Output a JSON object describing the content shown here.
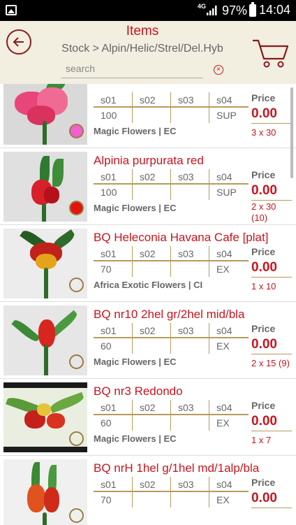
{
  "status_bar": {
    "network": "4G",
    "battery": "97%",
    "time": "14:04"
  },
  "header": {
    "title": "Items",
    "breadcrumb": "Stock > Alpin/Helic/Strel/Del.Hyb",
    "search_placeholder": "search"
  },
  "columns": [
    "s01",
    "s02",
    "s03",
    "s04"
  ],
  "price_label": "Price",
  "items": [
    {
      "name": "",
      "s01": "100",
      "s02": "",
      "s03": "",
      "s04": "SUP",
      "supplier": "Magic Flowers | EC",
      "price": "0.00",
      "packing": "3 x 30",
      "dot_color": "#f25fd0",
      "dot_filled": true
    },
    {
      "name": "Alpinia purpurata red",
      "s01": "100",
      "s02": "",
      "s03": "",
      "s04": "SUP",
      "supplier": "Magic Flowers | EC",
      "price": "0.00",
      "packing": "2 x 30",
      "packing2": "(10)",
      "dot_color": "#e4140e",
      "dot_filled": true
    },
    {
      "name": "BQ Heleconia Havana Cafe [plat]",
      "s01": "70",
      "s02": "",
      "s03": "",
      "s04": "EX",
      "supplier": "Africa Exotic Flowers | CI",
      "price": "0.00",
      "packing": "1 x 10",
      "dot_filled": false
    },
    {
      "name": "BQ nr10 2hel gr/2hel mid/bla",
      "s01": "60",
      "s02": "",
      "s03": "",
      "s04": "EX",
      "supplier": "Magic Flowers | EC",
      "price": "0.00",
      "packing": "2 x 15 (9)",
      "dot_filled": false
    },
    {
      "name": "BQ nr3 Redondo",
      "s01": "60",
      "s02": "",
      "s03": "",
      "s04": "EX",
      "supplier": "Magic Flowers | EC",
      "price": "0.00",
      "packing": "1 x 7",
      "dot_filled": false
    },
    {
      "name": "BQ nrH 1hel g/1hel md/1alp/bla",
      "s01": "70",
      "s02": "",
      "s03": "",
      "s04": "EX",
      "supplier": "",
      "price": "0.00",
      "packing": "",
      "dot_filled": false
    }
  ]
}
